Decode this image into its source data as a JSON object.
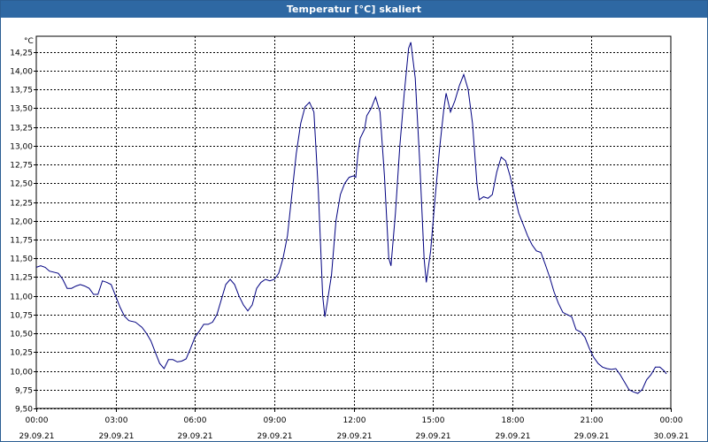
{
  "window": {
    "title": "Temperatur [°C] skaliert"
  },
  "colors": {
    "titlebar": "#2e68a3",
    "line": "#000080",
    "grid": "#000000",
    "background": "#ffffff"
  },
  "chart_data": {
    "type": "line",
    "title": "Temperatur [°C] skaliert",
    "ylabel": "°C",
    "xlabel": "",
    "ylim": [
      9.5,
      14.5
    ],
    "xlim": [
      "29.09.21 00:00",
      "30.09.21 00:00"
    ],
    "y_ticks": [
      "9,50",
      "9,75",
      "10,00",
      "10,25",
      "10,50",
      "10,75",
      "11,00",
      "11,25",
      "11,50",
      "11,75",
      "12,00",
      "12,25",
      "12,50",
      "12,75",
      "13,00",
      "13,25",
      "13,50",
      "13,75",
      "14,00",
      "14,25"
    ],
    "x_ticks": [
      {
        "time": "00:00",
        "date": "29.09.21"
      },
      {
        "time": "03:00",
        "date": "29.09.21"
      },
      {
        "time": "06:00",
        "date": "29.09.21"
      },
      {
        "time": "09:00",
        "date": "29.09.21"
      },
      {
        "time": "12:00",
        "date": "29.09.21"
      },
      {
        "time": "15:00",
        "date": "29.09.21"
      },
      {
        "time": "18:00",
        "date": "29.09.21"
      },
      {
        "time": "21:00",
        "date": "29.09.21"
      },
      {
        "time": "00:00",
        "date": "30.09.21"
      }
    ],
    "grid": true,
    "series": [
      {
        "values": [
          [
            "00:00",
            11.38
          ],
          [
            "00:10",
            11.4
          ],
          [
            "00:20",
            11.38
          ],
          [
            "00:30",
            11.33
          ],
          [
            "00:50",
            11.3
          ],
          [
            "01:00",
            11.22
          ],
          [
            "01:10",
            11.1
          ],
          [
            "01:20",
            11.1
          ],
          [
            "01:30",
            11.13
          ],
          [
            "01:40",
            11.15
          ],
          [
            "01:50",
            11.13
          ],
          [
            "02:00",
            11.1
          ],
          [
            "02:10",
            11.02
          ],
          [
            "02:20",
            11.02
          ],
          [
            "02:30",
            11.2
          ],
          [
            "02:40",
            11.18
          ],
          [
            "02:50",
            11.15
          ],
          [
            "03:00",
            11.0
          ],
          [
            "03:10",
            10.85
          ],
          [
            "03:20",
            10.73
          ],
          [
            "03:30",
            10.67
          ],
          [
            "03:45",
            10.65
          ],
          [
            "04:00",
            10.58
          ],
          [
            "04:10",
            10.5
          ],
          [
            "04:20",
            10.4
          ],
          [
            "04:30",
            10.25
          ],
          [
            "04:40",
            10.1
          ],
          [
            "04:50",
            10.03
          ],
          [
            "05:00",
            10.15
          ],
          [
            "05:10",
            10.15
          ],
          [
            "05:20",
            10.12
          ],
          [
            "05:30",
            10.13
          ],
          [
            "05:40",
            10.16
          ],
          [
            "05:50",
            10.3
          ],
          [
            "06:00",
            10.45
          ],
          [
            "06:10",
            10.53
          ],
          [
            "06:20",
            10.62
          ],
          [
            "06:30",
            10.62
          ],
          [
            "06:40",
            10.65
          ],
          [
            "06:50",
            10.75
          ],
          [
            "07:00",
            10.95
          ],
          [
            "07:10",
            11.15
          ],
          [
            "07:20",
            11.22
          ],
          [
            "07:30",
            11.15
          ],
          [
            "07:40",
            11.0
          ],
          [
            "07:50",
            10.88
          ],
          [
            "08:00",
            10.8
          ],
          [
            "08:10",
            10.88
          ],
          [
            "08:20",
            11.1
          ],
          [
            "08:30",
            11.18
          ],
          [
            "08:40",
            11.22
          ],
          [
            "08:50",
            11.2
          ],
          [
            "09:00",
            11.22
          ],
          [
            "09:10",
            11.3
          ],
          [
            "09:20",
            11.5
          ],
          [
            "09:30",
            11.8
          ],
          [
            "09:40",
            12.35
          ],
          [
            "09:50",
            12.9
          ],
          [
            "10:00",
            13.3
          ],
          [
            "10:10",
            13.52
          ],
          [
            "10:20",
            13.58
          ],
          [
            "10:30",
            13.45
          ],
          [
            "10:40",
            12.4
          ],
          [
            "10:50",
            11.0
          ],
          [
            "10:55",
            10.72
          ],
          [
            "11:00",
            10.9
          ],
          [
            "11:10",
            11.28
          ],
          [
            "11:20",
            12.0
          ],
          [
            "11:30",
            12.35
          ],
          [
            "11:40",
            12.5
          ],
          [
            "11:50",
            12.58
          ],
          [
            "12:00",
            12.6
          ],
          [
            "12:05",
            12.58
          ],
          [
            "12:10",
            12.9
          ],
          [
            "12:15",
            13.1
          ],
          [
            "12:25",
            13.22
          ],
          [
            "12:30",
            13.4
          ],
          [
            "12:40",
            13.5
          ],
          [
            "12:50",
            13.65
          ],
          [
            "13:00",
            13.45
          ],
          [
            "13:10",
            12.6
          ],
          [
            "13:20",
            11.5
          ],
          [
            "13:25",
            11.4
          ],
          [
            "13:35",
            12.1
          ],
          [
            "13:45",
            13.0
          ],
          [
            "13:55",
            13.7
          ],
          [
            "14:05",
            14.3
          ],
          [
            "14:10",
            14.38
          ],
          [
            "14:20",
            13.9
          ],
          [
            "14:30",
            12.8
          ],
          [
            "14:40",
            11.5
          ],
          [
            "14:45",
            11.18
          ],
          [
            "14:55",
            11.6
          ],
          [
            "15:05",
            12.3
          ],
          [
            "15:15",
            12.95
          ],
          [
            "15:25",
            13.5
          ],
          [
            "15:30",
            13.7
          ],
          [
            "15:40",
            13.45
          ],
          [
            "15:50",
            13.6
          ],
          [
            "16:00",
            13.8
          ],
          [
            "16:10",
            13.95
          ],
          [
            "16:20",
            13.75
          ],
          [
            "16:30",
            13.3
          ],
          [
            "16:40",
            12.5
          ],
          [
            "16:45",
            12.28
          ],
          [
            "16:55",
            12.32
          ],
          [
            "17:05",
            12.3
          ],
          [
            "17:15",
            12.35
          ],
          [
            "17:25",
            12.65
          ],
          [
            "17:35",
            12.85
          ],
          [
            "17:45",
            12.8
          ],
          [
            "17:55",
            12.6
          ],
          [
            "18:05",
            12.35
          ],
          [
            "18:15",
            12.1
          ],
          [
            "18:25",
            11.95
          ],
          [
            "18:35",
            11.8
          ],
          [
            "18:45",
            11.68
          ],
          [
            "18:55",
            11.6
          ],
          [
            "19:05",
            11.58
          ],
          [
            "19:15",
            11.42
          ],
          [
            "19:25",
            11.25
          ],
          [
            "19:35",
            11.05
          ],
          [
            "19:45",
            10.9
          ],
          [
            "19:55",
            10.78
          ],
          [
            "20:05",
            10.75
          ],
          [
            "20:15",
            10.72
          ],
          [
            "20:25",
            10.55
          ],
          [
            "20:35",
            10.52
          ],
          [
            "20:45",
            10.45
          ],
          [
            "20:55",
            10.3
          ],
          [
            "21:05",
            10.18
          ],
          [
            "21:15",
            10.1
          ],
          [
            "21:25",
            10.05
          ],
          [
            "21:35",
            10.03
          ],
          [
            "21:45",
            10.02
          ],
          [
            "21:55",
            10.03
          ],
          [
            "22:05",
            9.95
          ],
          [
            "22:15",
            9.85
          ],
          [
            "22:25",
            9.75
          ],
          [
            "22:35",
            9.72
          ],
          [
            "22:45",
            9.7
          ],
          [
            "22:55",
            9.75
          ],
          [
            "23:05",
            9.88
          ],
          [
            "23:15",
            9.95
          ],
          [
            "23:25",
            10.05
          ],
          [
            "23:35",
            10.05
          ],
          [
            "23:45",
            10.0
          ],
          [
            "23:50",
            9.96
          ]
        ]
      }
    ]
  }
}
